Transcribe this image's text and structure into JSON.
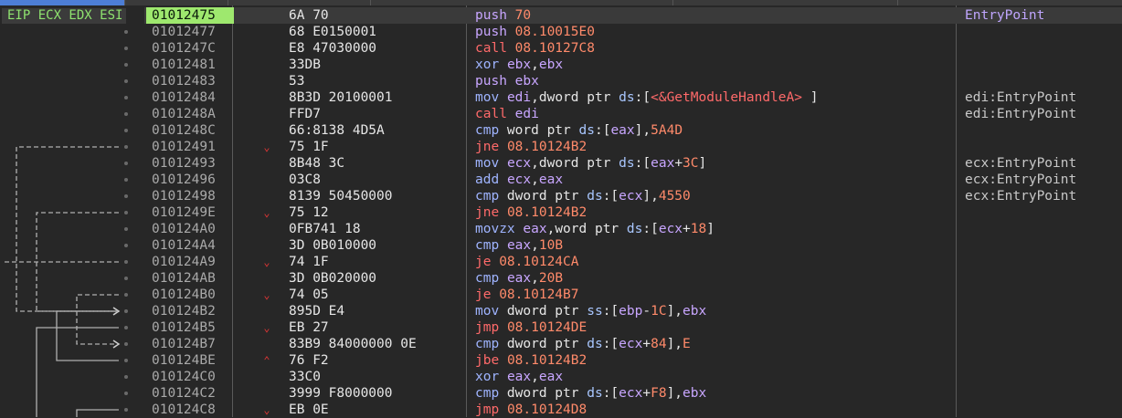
{
  "registers_label": "EIP ECX EDX ESI",
  "instructions": [
    {
      "address": "01012475",
      "bytes": "6A 70",
      "arrow": "",
      "comment": "EntryPoint",
      "comment_kind": "entry",
      "eip": true,
      "tokens": [
        {
          "t": "push",
          "c": "push"
        },
        {
          "t": " "
        },
        {
          "t": "70",
          "c": "num"
        }
      ]
    },
    {
      "address": "01012477",
      "bytes": "68 E0150001",
      "arrow": "",
      "comment": "",
      "tokens": [
        {
          "t": "push",
          "c": "push"
        },
        {
          "t": " "
        },
        {
          "t": "08.10015E0",
          "c": "num"
        }
      ]
    },
    {
      "address": "0101247C",
      "bytes": "E8 47030000",
      "arrow": "",
      "comment": "",
      "tokens": [
        {
          "t": "call",
          "c": "call"
        },
        {
          "t": " "
        },
        {
          "t": "08.10127C8",
          "c": "num"
        }
      ]
    },
    {
      "address": "01012481",
      "bytes": "33DB",
      "arrow": "",
      "comment": "",
      "tokens": [
        {
          "t": "xor",
          "c": "norm"
        },
        {
          "t": " "
        },
        {
          "t": "ebx",
          "c": "reg"
        },
        {
          "t": ","
        },
        {
          "t": "ebx",
          "c": "reg"
        }
      ]
    },
    {
      "address": "01012483",
      "bytes": "53",
      "arrow": "",
      "comment": "",
      "tokens": [
        {
          "t": "push",
          "c": "push"
        },
        {
          "t": " "
        },
        {
          "t": "ebx",
          "c": "reg"
        }
      ]
    },
    {
      "address": "01012484",
      "bytes": "8B3D 20100001",
      "arrow": "",
      "comment": "edi:EntryPoint",
      "tokens": [
        {
          "t": "mov",
          "c": "norm"
        },
        {
          "t": " "
        },
        {
          "t": "edi",
          "c": "reg"
        },
        {
          "t": ",dword ptr "
        },
        {
          "t": "ds",
          "c": "seg"
        },
        {
          "t": ":["
        },
        {
          "t": "<&GetModuleHandleA>",
          "c": "sym"
        },
        {
          "t": " ]"
        }
      ]
    },
    {
      "address": "0101248A",
      "bytes": "FFD7",
      "arrow": "",
      "comment": "edi:EntryPoint",
      "tokens": [
        {
          "t": "call",
          "c": "call"
        },
        {
          "t": " "
        },
        {
          "t": "edi",
          "c": "reg"
        }
      ]
    },
    {
      "address": "0101248C",
      "bytes": "66:8138 4D5A",
      "arrow": "",
      "comment": "",
      "tokens": [
        {
          "t": "cmp",
          "c": "norm"
        },
        {
          "t": " word ptr "
        },
        {
          "t": "ds",
          "c": "seg"
        },
        {
          "t": ":["
        },
        {
          "t": "eax",
          "c": "reg"
        },
        {
          "t": "],"
        },
        {
          "t": "5A4D",
          "c": "num"
        }
      ]
    },
    {
      "address": "01012491",
      "bytes": "75 1F",
      "arrow": "down",
      "comment": "",
      "tokens": [
        {
          "t": "jne",
          "c": "jmp"
        },
        {
          "t": " "
        },
        {
          "t": "08.10124B2",
          "c": "num"
        }
      ]
    },
    {
      "address": "01012493",
      "bytes": "8B48 3C",
      "arrow": "",
      "comment": "ecx:EntryPoint",
      "tokens": [
        {
          "t": "mov",
          "c": "norm"
        },
        {
          "t": " "
        },
        {
          "t": "ecx",
          "c": "reg"
        },
        {
          "t": ",dword ptr "
        },
        {
          "t": "ds",
          "c": "seg"
        },
        {
          "t": ":["
        },
        {
          "t": "eax",
          "c": "reg"
        },
        {
          "t": "+"
        },
        {
          "t": "3C",
          "c": "num"
        },
        {
          "t": "]"
        }
      ]
    },
    {
      "address": "01012496",
      "bytes": "03C8",
      "arrow": "",
      "comment": "ecx:EntryPoint",
      "tokens": [
        {
          "t": "add",
          "c": "norm"
        },
        {
          "t": " "
        },
        {
          "t": "ecx",
          "c": "reg"
        },
        {
          "t": ","
        },
        {
          "t": "eax",
          "c": "reg"
        }
      ]
    },
    {
      "address": "01012498",
      "bytes": "8139 50450000",
      "arrow": "",
      "comment": "ecx:EntryPoint",
      "tokens": [
        {
          "t": "cmp",
          "c": "norm"
        },
        {
          "t": " dword ptr "
        },
        {
          "t": "ds",
          "c": "seg"
        },
        {
          "t": ":["
        },
        {
          "t": "ecx",
          "c": "reg"
        },
        {
          "t": "],"
        },
        {
          "t": "4550",
          "c": "num"
        }
      ]
    },
    {
      "address": "0101249E",
      "bytes": "75 12",
      "arrow": "down",
      "comment": "",
      "tokens": [
        {
          "t": "jne",
          "c": "jmp"
        },
        {
          "t": " "
        },
        {
          "t": "08.10124B2",
          "c": "num"
        }
      ]
    },
    {
      "address": "010124A0",
      "bytes": "0FB741 18",
      "arrow": "",
      "comment": "",
      "tokens": [
        {
          "t": "movzx",
          "c": "norm"
        },
        {
          "t": " "
        },
        {
          "t": "eax",
          "c": "reg"
        },
        {
          "t": ",word ptr "
        },
        {
          "t": "ds",
          "c": "seg"
        },
        {
          "t": ":["
        },
        {
          "t": "ecx",
          "c": "reg"
        },
        {
          "t": "+"
        },
        {
          "t": "18",
          "c": "num"
        },
        {
          "t": "]"
        }
      ]
    },
    {
      "address": "010124A4",
      "bytes": "3D 0B010000",
      "arrow": "",
      "comment": "",
      "tokens": [
        {
          "t": "cmp",
          "c": "norm"
        },
        {
          "t": " "
        },
        {
          "t": "eax",
          "c": "reg"
        },
        {
          "t": ","
        },
        {
          "t": "10B",
          "c": "num"
        }
      ]
    },
    {
      "address": "010124A9",
      "bytes": "74 1F",
      "arrow": "down",
      "comment": "",
      "tokens": [
        {
          "t": "je",
          "c": "jmp"
        },
        {
          "t": " "
        },
        {
          "t": "08.10124CA",
          "c": "num"
        }
      ]
    },
    {
      "address": "010124AB",
      "bytes": "3D 0B020000",
      "arrow": "",
      "comment": "",
      "tokens": [
        {
          "t": "cmp",
          "c": "norm"
        },
        {
          "t": " "
        },
        {
          "t": "eax",
          "c": "reg"
        },
        {
          "t": ","
        },
        {
          "t": "20B",
          "c": "num"
        }
      ]
    },
    {
      "address": "010124B0",
      "bytes": "74 05",
      "arrow": "down",
      "comment": "",
      "tokens": [
        {
          "t": "je",
          "c": "jmp"
        },
        {
          "t": " "
        },
        {
          "t": "08.10124B7",
          "c": "num"
        }
      ]
    },
    {
      "address": "010124B2",
      "bytes": "895D E4",
      "arrow": "",
      "comment": "",
      "tokens": [
        {
          "t": "mov",
          "c": "norm"
        },
        {
          "t": " dword ptr "
        },
        {
          "t": "ss",
          "c": "seg"
        },
        {
          "t": ":["
        },
        {
          "t": "ebp",
          "c": "reg"
        },
        {
          "t": "-"
        },
        {
          "t": "1C",
          "c": "num"
        },
        {
          "t": "],"
        },
        {
          "t": "ebx",
          "c": "reg"
        }
      ]
    },
    {
      "address": "010124B5",
      "bytes": "EB 27",
      "arrow": "down",
      "comment": "",
      "tokens": [
        {
          "t": "jmp",
          "c": "jmp"
        },
        {
          "t": " "
        },
        {
          "t": "08.10124DE",
          "c": "num"
        }
      ]
    },
    {
      "address": "010124B7",
      "bytes": "83B9 84000000 0E",
      "arrow": "",
      "comment": "",
      "tokens": [
        {
          "t": "cmp",
          "c": "norm"
        },
        {
          "t": " dword ptr "
        },
        {
          "t": "ds",
          "c": "seg"
        },
        {
          "t": ":["
        },
        {
          "t": "ecx",
          "c": "reg"
        },
        {
          "t": "+"
        },
        {
          "t": "84",
          "c": "num"
        },
        {
          "t": "],"
        },
        {
          "t": "E",
          "c": "num"
        }
      ]
    },
    {
      "address": "010124BE",
      "bytes": "76 F2",
      "arrow": "up",
      "comment": "",
      "tokens": [
        {
          "t": "jbe",
          "c": "jmp"
        },
        {
          "t": " "
        },
        {
          "t": "08.10124B2",
          "c": "num"
        }
      ]
    },
    {
      "address": "010124C0",
      "bytes": "33C0",
      "arrow": "",
      "comment": "",
      "tokens": [
        {
          "t": "xor",
          "c": "norm"
        },
        {
          "t": " "
        },
        {
          "t": "eax",
          "c": "reg"
        },
        {
          "t": ","
        },
        {
          "t": "eax",
          "c": "reg"
        }
      ]
    },
    {
      "address": "010124C2",
      "bytes": "3999 F8000000",
      "arrow": "",
      "comment": "",
      "tokens": [
        {
          "t": "cmp",
          "c": "norm"
        },
        {
          "t": " dword ptr "
        },
        {
          "t": "ds",
          "c": "seg"
        },
        {
          "t": ":["
        },
        {
          "t": "ecx",
          "c": "reg"
        },
        {
          "t": "+"
        },
        {
          "t": "F8",
          "c": "num"
        },
        {
          "t": "],"
        },
        {
          "t": "ebx",
          "c": "reg"
        }
      ]
    },
    {
      "address": "010124C8",
      "bytes": "EB 0E",
      "arrow": "down",
      "comment": "",
      "tokens": [
        {
          "t": "jmp",
          "c": "jmp"
        },
        {
          "t": " "
        },
        {
          "t": "08.10124D8",
          "c": "num"
        }
      ]
    }
  ]
}
